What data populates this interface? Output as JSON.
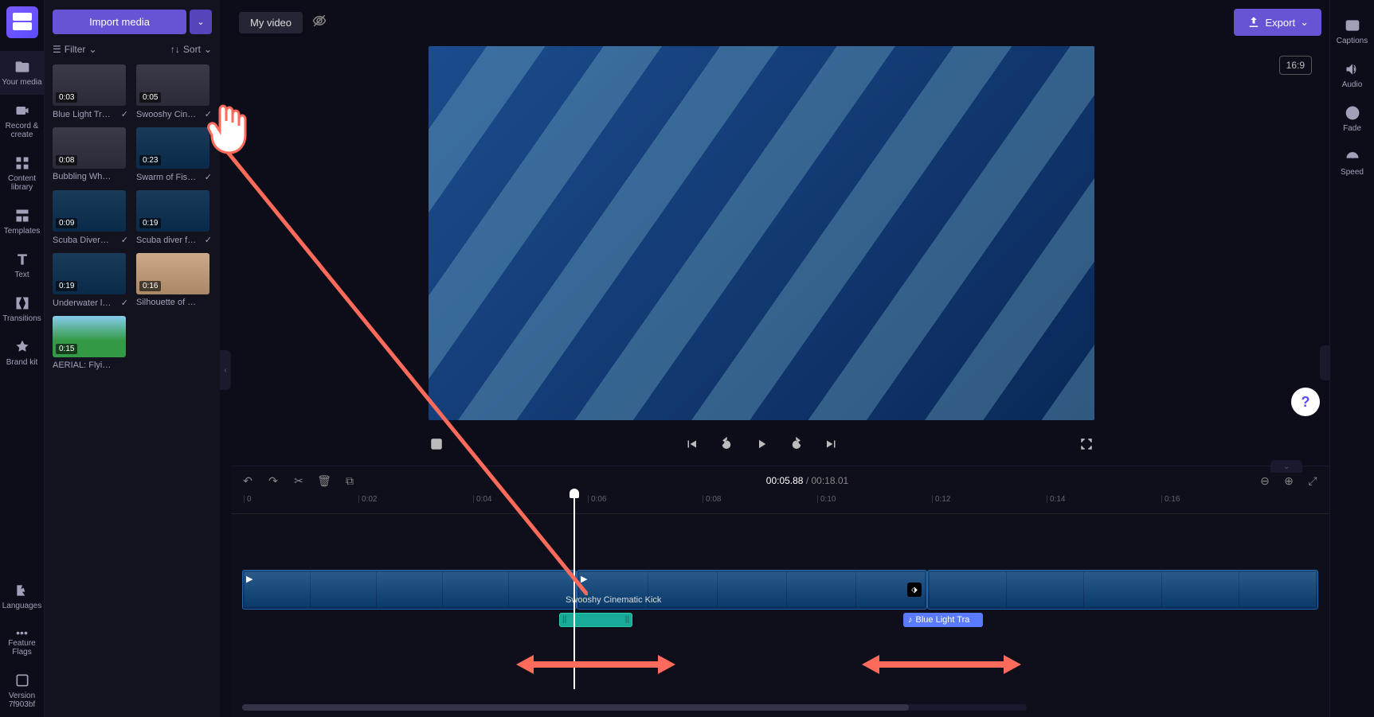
{
  "app": {
    "title": "My video",
    "export_label": "Export",
    "aspect": "16:9"
  },
  "import": {
    "button": "Import media"
  },
  "filter_sort": {
    "filter": "Filter",
    "sort": "Sort"
  },
  "left_rail": [
    {
      "label": "Your media",
      "icon": "folder"
    },
    {
      "label": "Record & create",
      "icon": "record"
    },
    {
      "label": "Content library",
      "icon": "library"
    },
    {
      "label": "Templates",
      "icon": "templates"
    },
    {
      "label": "Text",
      "icon": "text"
    },
    {
      "label": "Transitions",
      "icon": "transitions"
    },
    {
      "label": "Brand kit",
      "icon": "brand"
    }
  ],
  "left_rail_bottom": [
    {
      "label": "Languages"
    },
    {
      "label": "Feature Flags"
    },
    {
      "label": "Version 7f903bf"
    }
  ],
  "right_rail": [
    {
      "label": "Captions"
    },
    {
      "label": "Audio"
    },
    {
      "label": "Fade"
    },
    {
      "label": "Speed"
    }
  ],
  "media": [
    {
      "name": "Blue Light Tra...",
      "dur": "0:03",
      "kind": "audio",
      "used": true
    },
    {
      "name": "Swooshy Cine...",
      "dur": "0:05",
      "kind": "audio",
      "used": true
    },
    {
      "name": "Bubbling Whoosh",
      "dur": "0:08",
      "kind": "audio",
      "used": false
    },
    {
      "name": "Swarm of Fish...",
      "dur": "0:23",
      "kind": "video",
      "used": true
    },
    {
      "name": "Scuba Divers ...",
      "dur": "0:09",
      "kind": "video",
      "used": true
    },
    {
      "name": "Scuba diver float...",
      "dur": "0:19",
      "kind": "video",
      "used": true
    },
    {
      "name": "Underwater la...",
      "dur": "0:19",
      "kind": "video",
      "used": true
    },
    {
      "name": "Silhouette of be...",
      "dur": "0:16",
      "kind": "yoga",
      "used": false
    },
    {
      "name": "AERIAL: Flying a...",
      "dur": "0:15",
      "kind": "beach",
      "used": false
    }
  ],
  "timeline": {
    "current": "00:05.88",
    "total": "00:18.01",
    "ticks": [
      "0",
      "0:02",
      "0:04",
      "0:06",
      "0:08",
      "0:10",
      "0:12",
      "0:14",
      "0:16"
    ],
    "audio_label_1": "Swooshy Cinematic Kick",
    "audio_clip_2": "Blue Light Tra"
  },
  "help": "?"
}
